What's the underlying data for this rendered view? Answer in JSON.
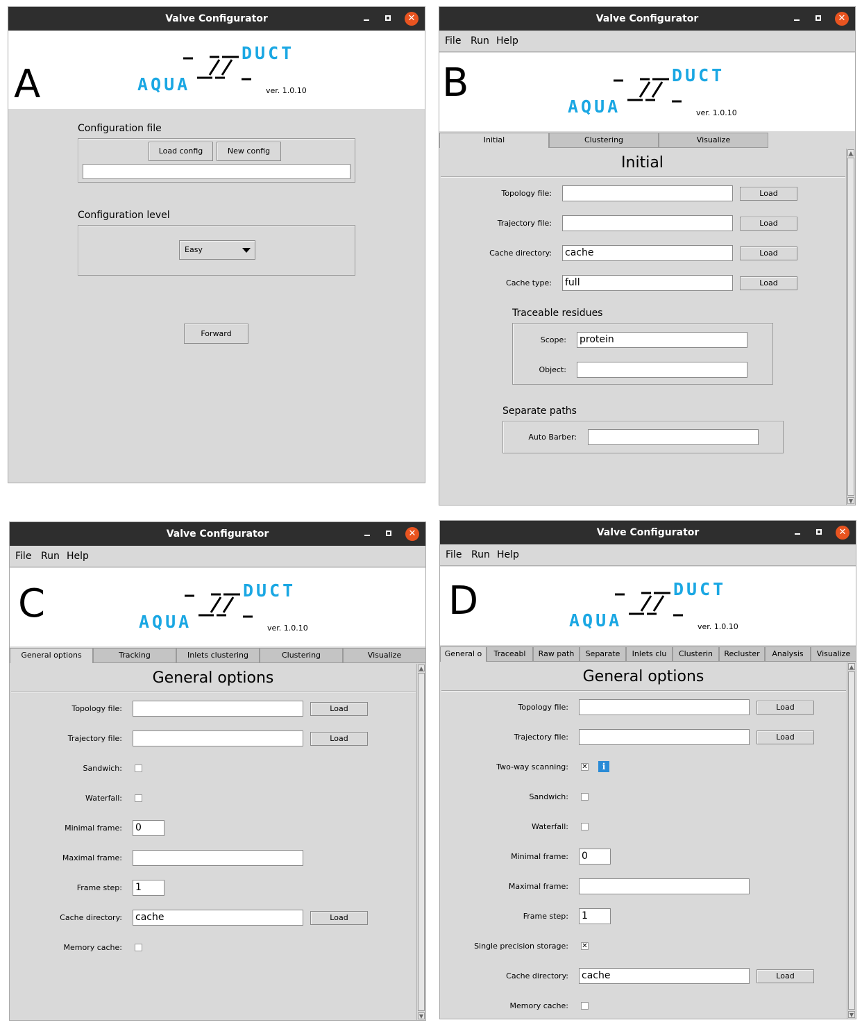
{
  "window_title": "Valve Configurator",
  "close_glyph": "✕",
  "menu": {
    "file": "File",
    "run": "Run",
    "help": "Help"
  },
  "logo": {
    "aqua": "AQUA",
    "duct": "DUCT",
    "version": "ver. 1.0.10"
  },
  "load": "Load",
  "panel_a": {
    "letter": "A",
    "config_file_title": "Configuration file",
    "load_config": "Load config",
    "new_config": "New config",
    "config_path": "",
    "config_level_title": "Configuration level",
    "level_selected": "Easy",
    "forward": "Forward"
  },
  "panel_b": {
    "letter": "B",
    "tabs": [
      "Initial",
      "Clustering",
      "Visualize"
    ],
    "title": "Initial",
    "topology_label": "Topology file:",
    "topology_value": "",
    "trajectory_label": "Trajectory file:",
    "trajectory_value": "",
    "cache_dir_label": "Cache directory:",
    "cache_dir_value": "cache",
    "cache_type_label": "Cache type:",
    "cache_type_value": "full",
    "traceable_title": "Traceable residues",
    "scope_label": "Scope:",
    "scope_value": "protein",
    "object_label": "Object:",
    "object_value": "",
    "separate_title": "Separate paths",
    "auto_barber_label": "Auto Barber:",
    "auto_barber_value": ""
  },
  "panel_c": {
    "letter": "C",
    "tabs": [
      "General options",
      "Tracking",
      "Inlets clustering",
      "Clustering",
      "Visualize"
    ],
    "title": "General options",
    "topology_label": "Topology file:",
    "trajectory_label": "Trajectory file:",
    "sandwich_label": "Sandwich:",
    "waterfall_label": "Waterfall:",
    "min_frame_label": "Minimal frame:",
    "min_frame_value": "0",
    "max_frame_label": "Maximal frame:",
    "frame_step_label": "Frame step:",
    "frame_step_value": "1",
    "cache_dir_label": "Cache directory:",
    "cache_dir_value": "cache",
    "memory_cache_label": "Memory cache:"
  },
  "panel_d": {
    "letter": "D",
    "tabs": [
      "General o",
      "Traceabl",
      "Raw path",
      "Separate",
      "Inlets clu",
      "Clusterin",
      "Recluster",
      "Analysis",
      "Visualize"
    ],
    "title": "General options",
    "topology_label": "Topology file:",
    "trajectory_label": "Trajectory file:",
    "two_way_label": "Two-way scanning:",
    "two_way_checked": "✕",
    "info_glyph": "i",
    "sandwich_label": "Sandwich:",
    "waterfall_label": "Waterfall:",
    "min_frame_label": "Minimal frame:",
    "min_frame_value": "0",
    "max_frame_label": "Maximal frame:",
    "frame_step_label": "Frame step:",
    "frame_step_value": "1",
    "single_precision_label": "Single precision storage:",
    "single_precision_checked": "✕",
    "cache_dir_label": "Cache directory:",
    "cache_dir_value": "cache",
    "memory_cache_label": "Memory cache:"
  }
}
